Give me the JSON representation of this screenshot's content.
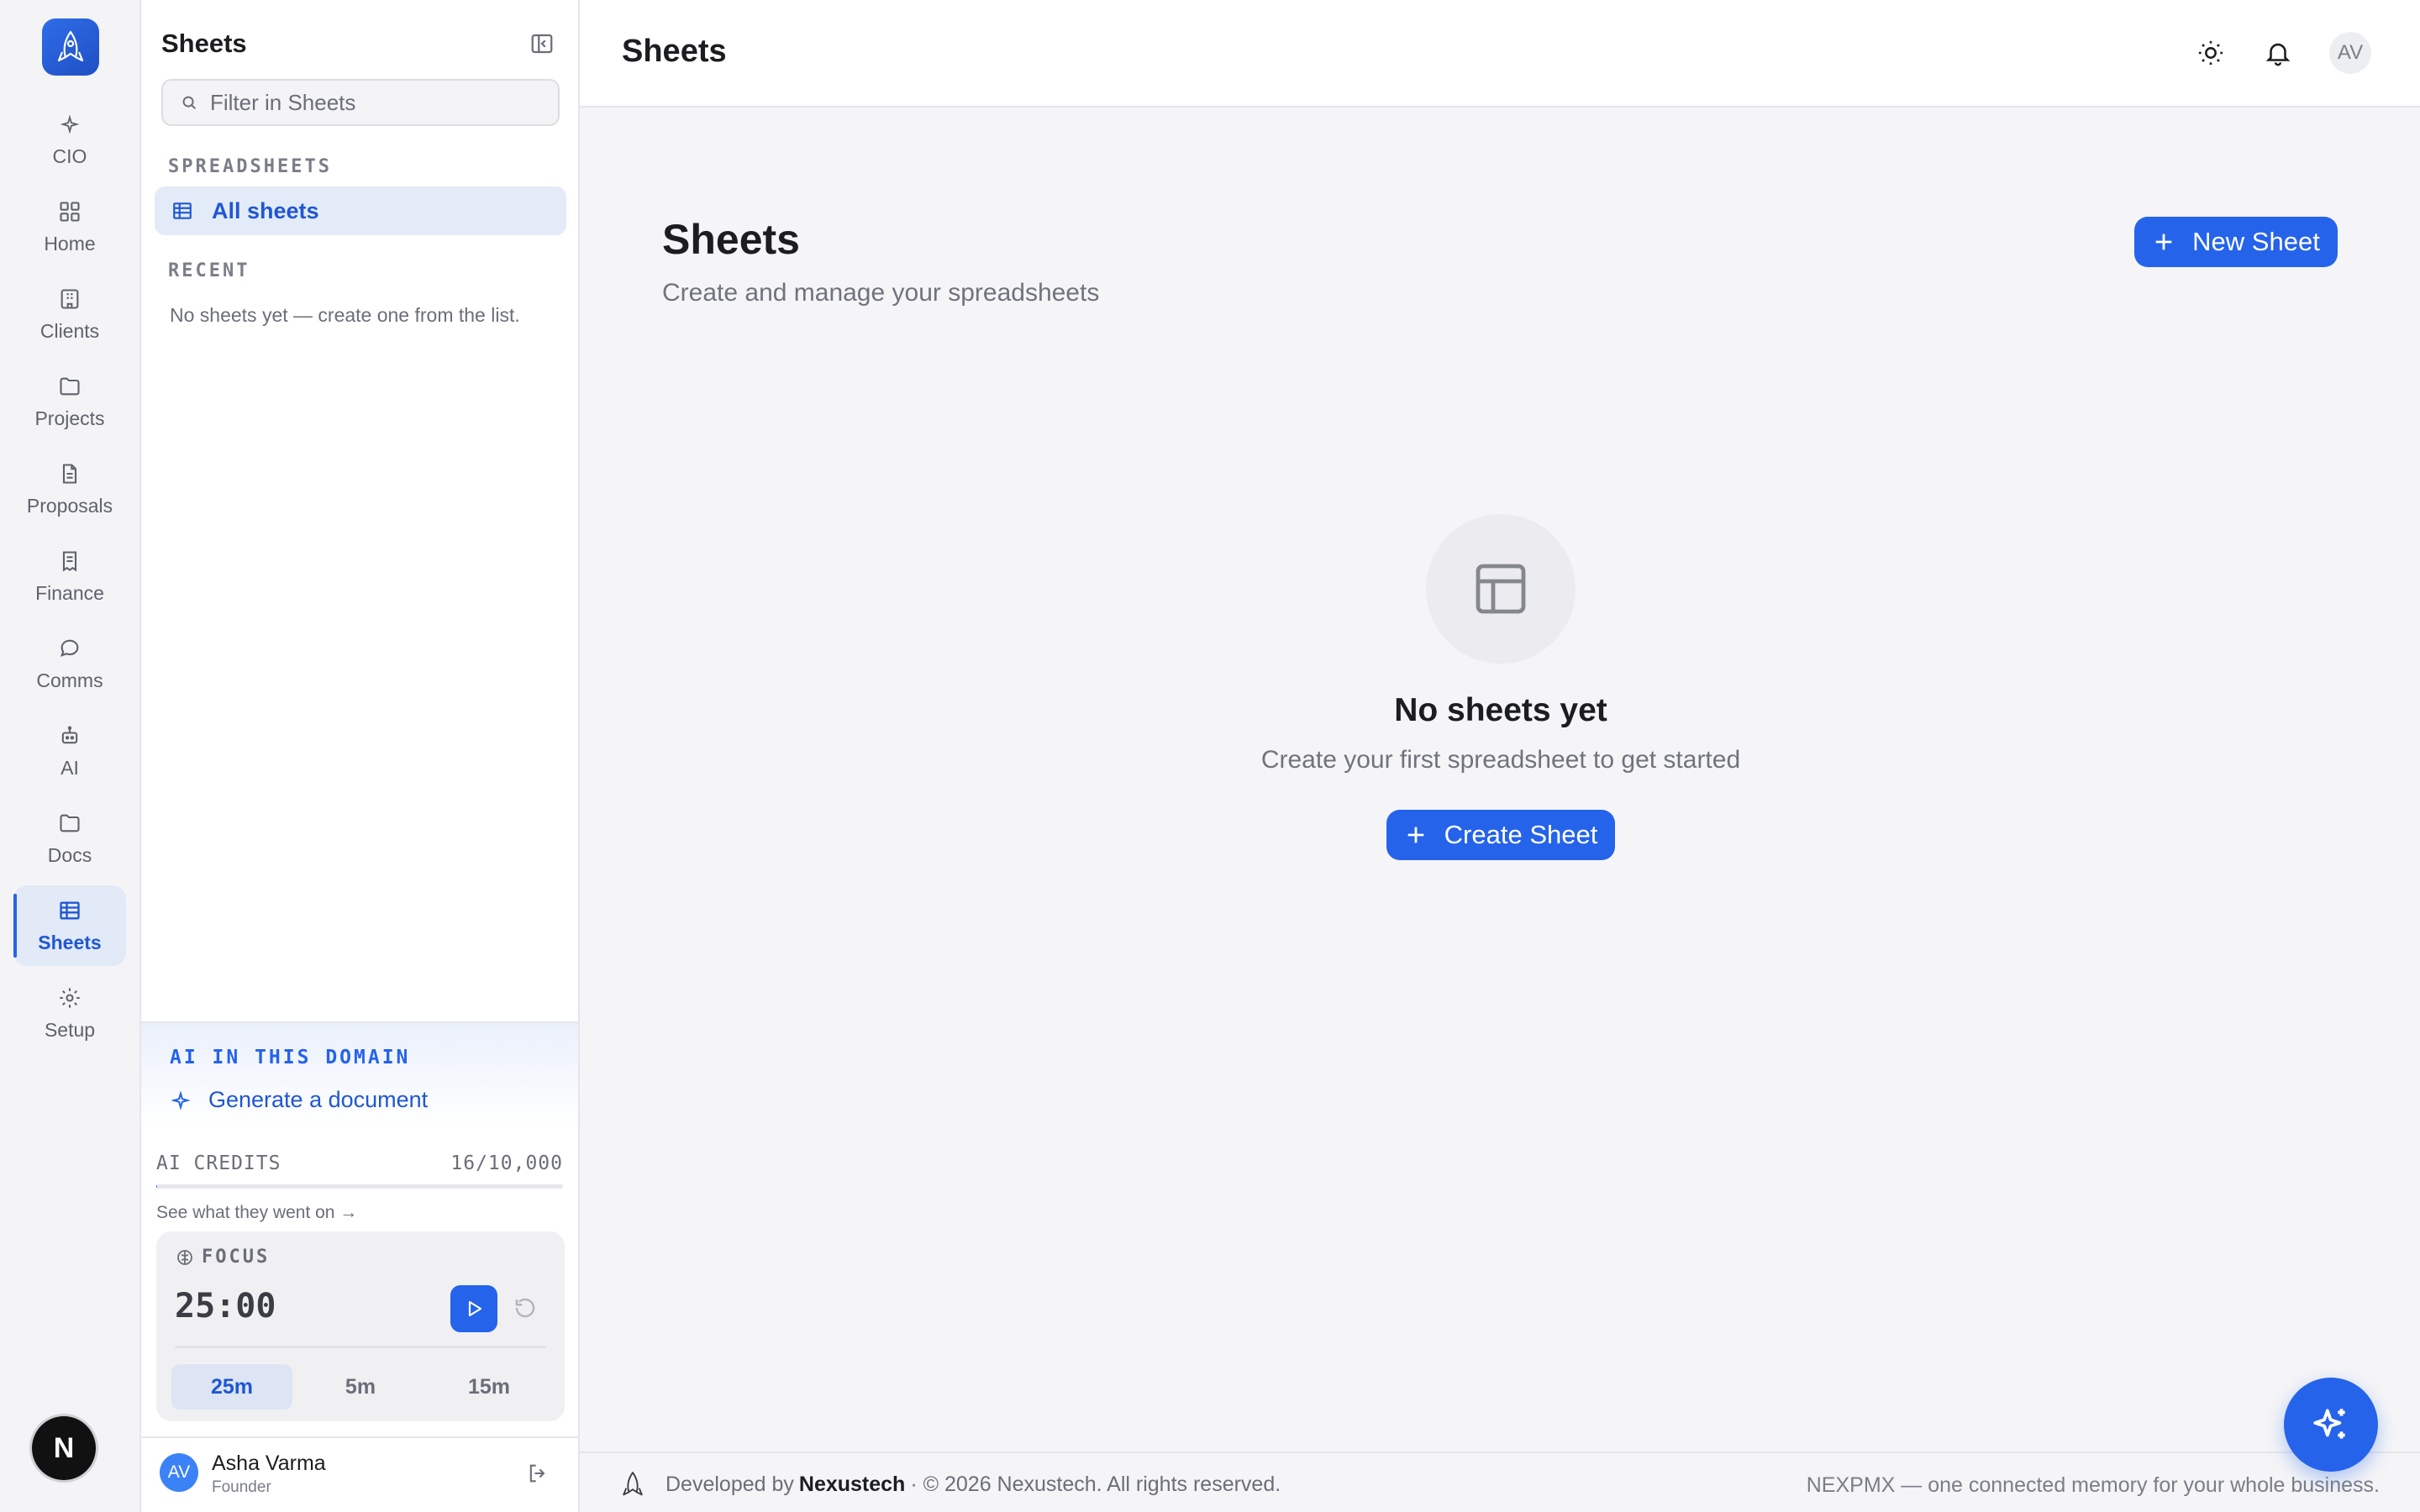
{
  "rail": {
    "items": [
      {
        "label": "CIO",
        "icon": "sparkle-icon"
      },
      {
        "label": "Home",
        "icon": "grid-icon"
      },
      {
        "label": "Clients",
        "icon": "building-icon"
      },
      {
        "label": "Projects",
        "icon": "folder-icon"
      },
      {
        "label": "Proposals",
        "icon": "document-icon"
      },
      {
        "label": "Finance",
        "icon": "receipt-icon"
      },
      {
        "label": "Comms",
        "icon": "chat-icon"
      },
      {
        "label": "AI",
        "icon": "robot-icon"
      },
      {
        "label": "Docs",
        "icon": "folder-icon"
      },
      {
        "label": "Sheets",
        "icon": "table-icon",
        "active": true
      },
      {
        "label": "Setup",
        "icon": "gear-icon"
      }
    ],
    "bottom_badge": "N"
  },
  "sidebar": {
    "title": "Sheets",
    "search_placeholder": "Filter in Sheets",
    "section_spreadsheets": "SPREADSHEETS",
    "active_item": "All sheets",
    "section_recent": "RECENT",
    "recent_empty": "No sheets yet — create one from the list.",
    "ai_domain_label": "AI IN THIS DOMAIN",
    "ai_domain_action": "Generate a document",
    "credits_label": "AI CREDITS",
    "credits_value": "16/10,000",
    "credits_used_fraction": 0.0016,
    "credits_link": "See what they went on →",
    "focus": {
      "label": "FOCUS",
      "time": "25:00",
      "presets": [
        "25m",
        "5m",
        "15m"
      ],
      "active_preset": "25m"
    },
    "user": {
      "initials": "AV",
      "name": "Asha Varma",
      "role": "Founder"
    }
  },
  "topbar": {
    "title": "Sheets",
    "avatar": "AV"
  },
  "main": {
    "title": "Sheets",
    "subtitle": "Create and manage your spreadsheets",
    "new_button": "New Sheet",
    "empty_title": "No sheets yet",
    "empty_subtitle": "Create your first spreadsheet to get started",
    "create_button": "Create Sheet"
  },
  "footer": {
    "developed_by": "Developed by",
    "brand": "Nexustech",
    "copyright": "· © 2026 Nexustech. All rights reserved.",
    "tagline": "NEXPMX — one connected memory for your whole business."
  },
  "colors": {
    "accent": "#2563eb",
    "accent_text": "#1f57d3",
    "active_bg": "#e4ebf8"
  }
}
